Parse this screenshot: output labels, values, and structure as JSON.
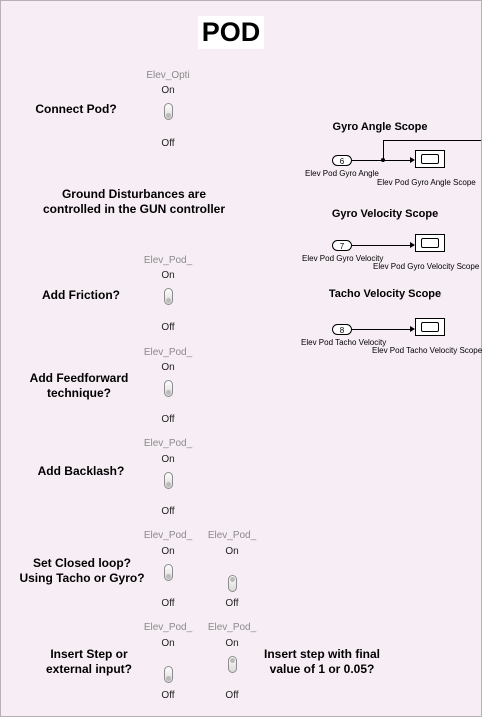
{
  "title": "POD",
  "labels": {
    "connect_pod": "Connect Pod?",
    "ground": "Ground Disturbances are controlled in the GUN controller",
    "friction": "Add Friction?",
    "feedforward": "Add Feedforward technique?",
    "backlash": "Add Backlash?",
    "closed_loop": "Set Closed loop? Using Tacho or Gyro?",
    "insert_step": "Insert Step or external input?",
    "step_value": "Insert step with final value of 1 or 0.05?"
  },
  "switches": [
    {
      "name": "Elev_Opti",
      "on": "On",
      "off": "Off",
      "state": "off"
    },
    {
      "name": "Elev_Pod_",
      "on": "On",
      "off": "Off",
      "state": "off"
    },
    {
      "name": "Elev_Pod_",
      "on": "On",
      "off": "Off",
      "state": "off"
    },
    {
      "name": "Elev_Pod_",
      "on": "On",
      "off": "Off",
      "state": "off"
    },
    {
      "name": "Elev_Pod_",
      "on": "On",
      "off": "Off",
      "state": "off"
    },
    {
      "name": "Elev_Pod_",
      "on": "On",
      "off": "Off",
      "state": "on"
    },
    {
      "name": "Elev_Pod_",
      "on": "On",
      "off": "Off",
      "state": "off"
    },
    {
      "name": "Elev_Pod_",
      "on": "On",
      "off": "Off",
      "state": "on"
    }
  ],
  "scopes": [
    {
      "title": "Gyro Angle Scope",
      "port": "6",
      "port_label": "Elev Pod Gyro Angle",
      "scope_label": "Elev Pod Gyro Angle Scope"
    },
    {
      "title": "Gyro Velocity Scope",
      "port": "7",
      "port_label": "Elev Pod Gyro Velocity",
      "scope_label": "Elev Pod Gyro Velocity Scope"
    },
    {
      "title": "Tacho Velocity Scope",
      "port": "8",
      "port_label": "Elev Pod Tacho Velocity",
      "scope_label": "Elev Pod Tacho Velocity Scope"
    }
  ]
}
